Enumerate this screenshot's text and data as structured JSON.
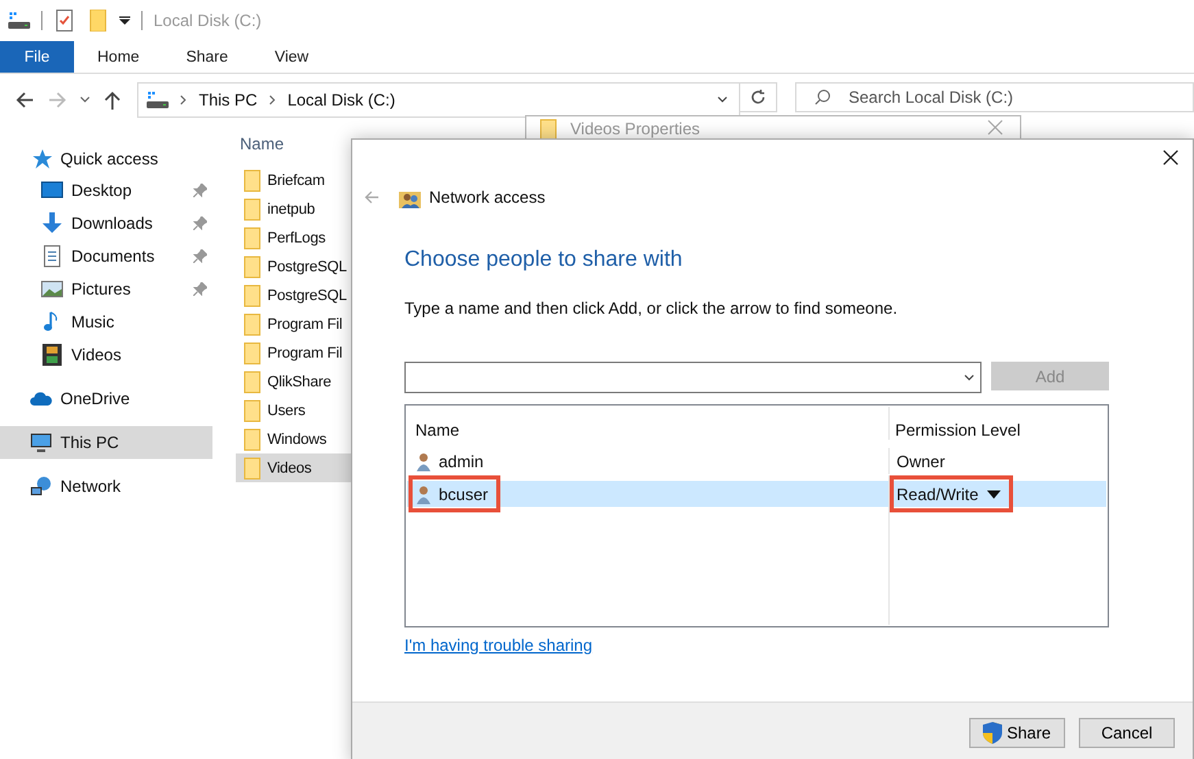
{
  "explorer": {
    "title": "Local Disk (C:)",
    "ribbon_tabs": [
      {
        "label": "File",
        "selected": true
      },
      {
        "label": "Home",
        "selected": false
      },
      {
        "label": "Share",
        "selected": false
      },
      {
        "label": "View",
        "selected": false
      }
    ],
    "breadcrumb": [
      "This PC",
      "Local Disk (C:)"
    ],
    "search": {
      "placeholder": "Search Local Disk (C:)"
    },
    "nav": [
      {
        "label": "Quick access",
        "kind": "star",
        "selected": false,
        "children": [
          {
            "label": "Desktop",
            "kind": "desktop",
            "pinned": true
          },
          {
            "label": "Downloads",
            "kind": "download",
            "pinned": true
          },
          {
            "label": "Documents",
            "kind": "document",
            "pinned": true
          },
          {
            "label": "Pictures",
            "kind": "pictures",
            "pinned": true
          },
          {
            "label": "Music",
            "kind": "music",
            "pinned": false
          },
          {
            "label": "Videos",
            "kind": "film",
            "pinned": false
          }
        ]
      },
      {
        "label": "OneDrive",
        "kind": "cloud",
        "selected": false
      },
      {
        "label": "This PC",
        "kind": "computer",
        "selected": true
      },
      {
        "label": "Network",
        "kind": "network",
        "selected": false
      }
    ],
    "column_header": "Name",
    "folders": [
      {
        "name": "Briefcam",
        "selected": false
      },
      {
        "name": "inetpub",
        "selected": false
      },
      {
        "name": "PerfLogs",
        "selected": false
      },
      {
        "name": "PostgreSQL",
        "selected": false
      },
      {
        "name": "PostgreSQL",
        "selected": false
      },
      {
        "name": "Program Fil",
        "selected": false
      },
      {
        "name": "Program Fil",
        "selected": false
      },
      {
        "name": "QlikShare",
        "selected": false
      },
      {
        "name": "Users",
        "selected": false
      },
      {
        "name": "Windows",
        "selected": false
      },
      {
        "name": "Videos",
        "selected": true
      }
    ]
  },
  "properties_window": {
    "title": "Videos Properties"
  },
  "dialog": {
    "title": "Network access",
    "heading": "Choose people to share with",
    "instruction": "Type a name and then click Add, or click the arrow to find someone.",
    "add_button": {
      "label": "Add",
      "disabled": true
    },
    "columns": [
      "Name",
      "Permission Level"
    ],
    "users": [
      {
        "name": "admin",
        "permission": "Owner",
        "selected": false,
        "highlighted": false,
        "dropdown": false
      },
      {
        "name": "bcuser",
        "permission": "Read/Write",
        "selected": true,
        "highlighted": true,
        "dropdown": true
      }
    ],
    "link": "I'm having trouble sharing",
    "buttons": [
      {
        "label": "Share",
        "kind": "shield"
      },
      {
        "label": "Cancel",
        "kind": "plain"
      }
    ]
  }
}
